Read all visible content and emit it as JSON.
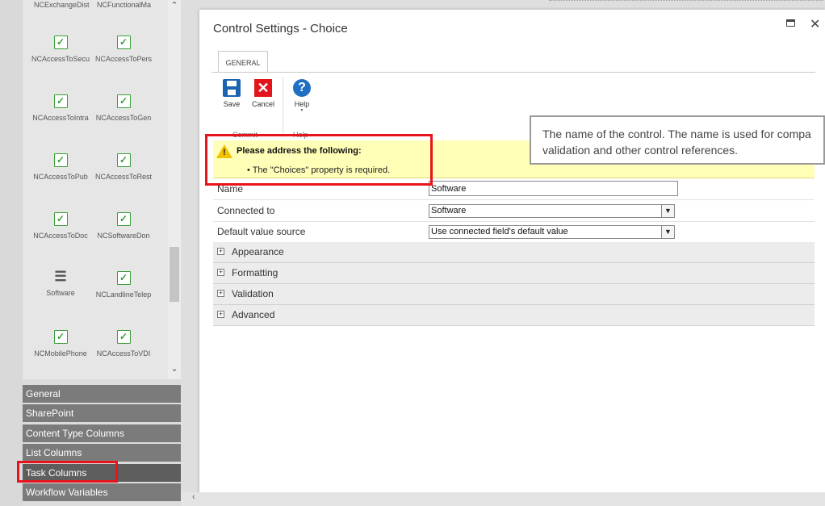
{
  "palette": {
    "top_row": [
      "NCExchangeDist",
      "NCFunctionalMa"
    ],
    "tools": [
      {
        "label": "NCAccessToSecu",
        "icon": "checkbox-icon"
      },
      {
        "label": "NCAccessToPers",
        "icon": "checkbox-icon"
      },
      {
        "label": "NCAccessToIntra",
        "icon": "checkbox-icon"
      },
      {
        "label": "NCAccessToGen",
        "icon": "checkbox-icon"
      },
      {
        "label": "NCAccessToPub",
        "icon": "checkbox-icon"
      },
      {
        "label": "NCAccessToRest",
        "icon": "checkbox-icon"
      },
      {
        "label": "NCAccessToDoc",
        "icon": "checkbox-icon"
      },
      {
        "label": "NCSoftwareDon",
        "icon": "checkbox-icon"
      },
      {
        "label": "Software",
        "icon": "list-icon"
      },
      {
        "label": "NCLandlineTelep",
        "icon": "checkbox-icon"
      },
      {
        "label": "NCMobilePhone",
        "icon": "checkbox-icon"
      },
      {
        "label": "NCAccessToVDI",
        "icon": "checkbox-icon"
      }
    ],
    "checkbox_glyph": "✓",
    "list_glyph": "☰",
    "scroll_up": "⌃",
    "scroll_down": "⌄"
  },
  "categories": [
    {
      "label": "General"
    },
    {
      "label": "SharePoint"
    },
    {
      "label": "Content Type Columns"
    },
    {
      "label": "List Columns"
    },
    {
      "label": "Task Columns"
    },
    {
      "label": "Workflow Variables"
    }
  ],
  "dialog": {
    "title": "Control Settings - Choice",
    "close_glyph": "✕",
    "tab_label": "GENERAL",
    "ribbon": {
      "save_label": "Save",
      "cancel_label": "Cancel",
      "help_label": "Help",
      "cancel_glyph": "✕",
      "help_glyph": "?",
      "help_caret": "▾",
      "group_commit": "Commit",
      "group_help": "Help"
    },
    "tooltip": {
      "line1": "The name of the control. The name is used for compa",
      "line2": "validation and other control references."
    },
    "validation": {
      "title": "Please address the following:",
      "item": "• The \"Choices\" property is required.",
      "warn_glyph": "!"
    },
    "properties": {
      "name": {
        "label": "Name",
        "value": "Software"
      },
      "connected_to": {
        "label": "Connected to",
        "value": "Software"
      },
      "default_value_source": {
        "label": "Default value source",
        "value": "Use connected field's default value"
      },
      "select_arrow": "▼"
    },
    "sections": [
      {
        "label": "Appearance"
      },
      {
        "label": "Formatting"
      },
      {
        "label": "Validation"
      },
      {
        "label": "Advanced"
      }
    ],
    "expand_glyph": "+"
  },
  "bottom_scroll_arrow": "‹",
  "colors": {
    "highlight_red": "#e8141b",
    "validation_bg": "#ffffb8",
    "category_bg": "#7b7b7b"
  }
}
